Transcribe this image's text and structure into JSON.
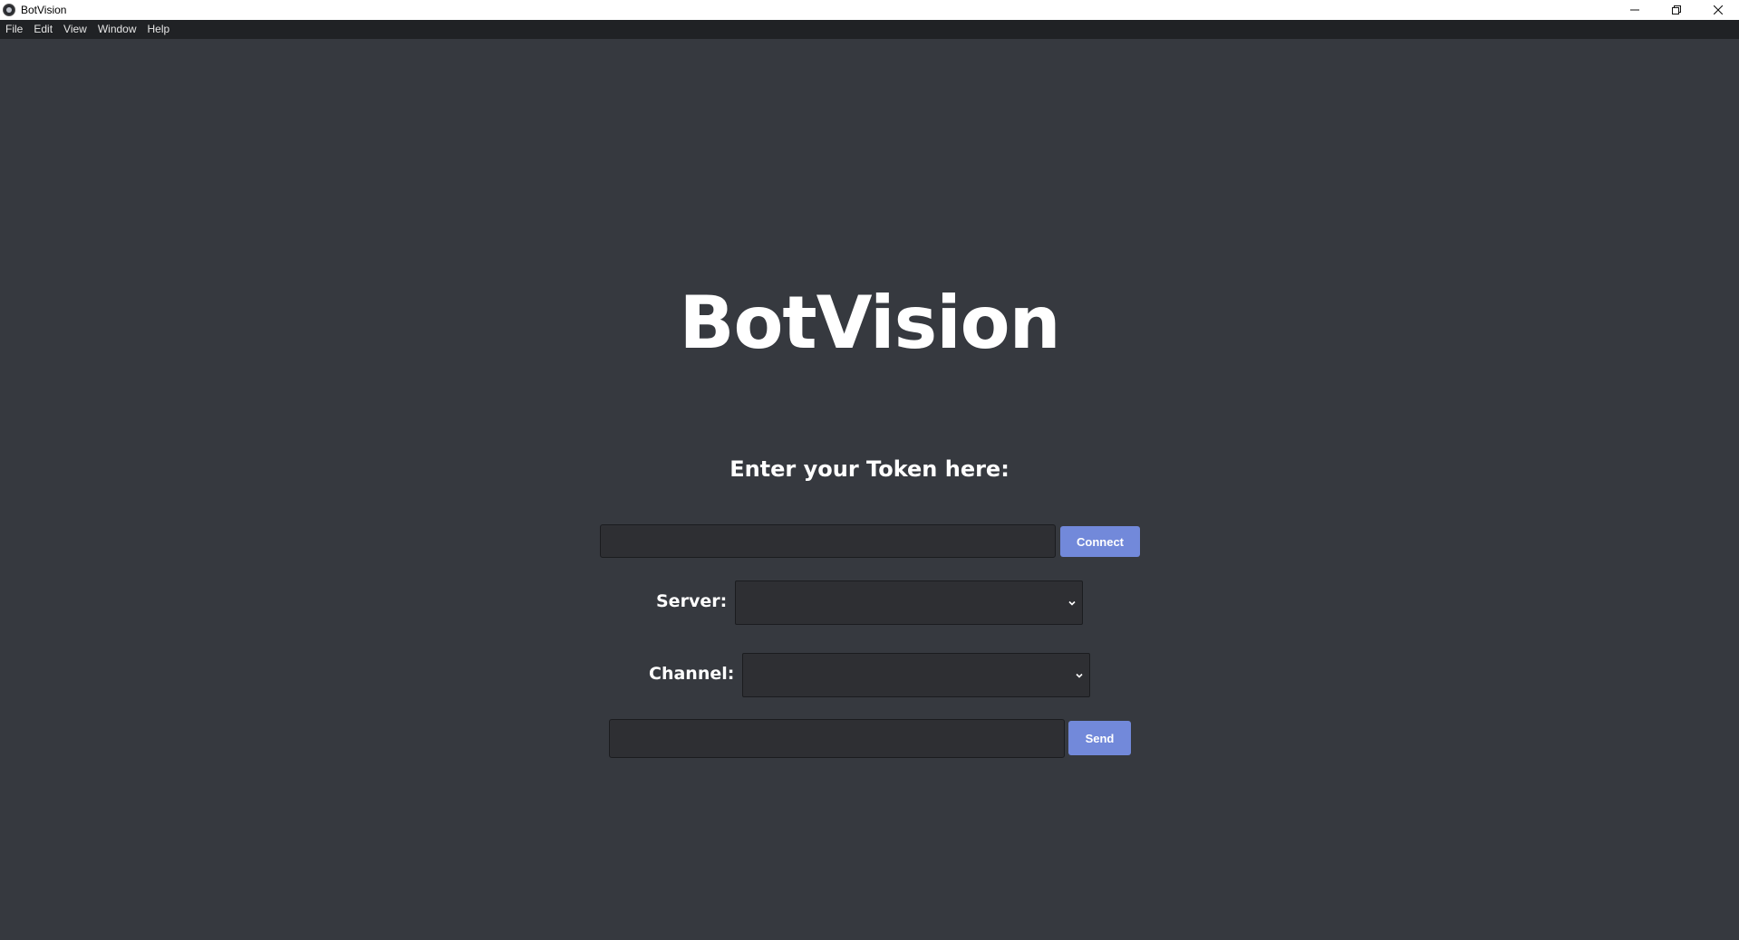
{
  "window": {
    "title": "BotVision"
  },
  "menu": {
    "items": [
      "File",
      "Edit",
      "View",
      "Window",
      "Help"
    ]
  },
  "main": {
    "heading": "BotVision",
    "token_label": "Enter your Token here:",
    "token_input": {
      "value": "",
      "placeholder": ""
    },
    "connect_label": "Connect",
    "server_label": "Server:",
    "server_selected": "",
    "channel_label": "Channel:",
    "channel_selected": "",
    "message_input": {
      "value": "",
      "placeholder": ""
    },
    "send_label": "Send"
  },
  "colors": {
    "background": "#36393f",
    "menubar": "#202225",
    "accent": "#7289da",
    "input_bg": "#2e2f33"
  },
  "icons": [
    "app-icon",
    "minimize-icon",
    "restore-icon",
    "close-icon",
    "chevron-down-icon"
  ]
}
